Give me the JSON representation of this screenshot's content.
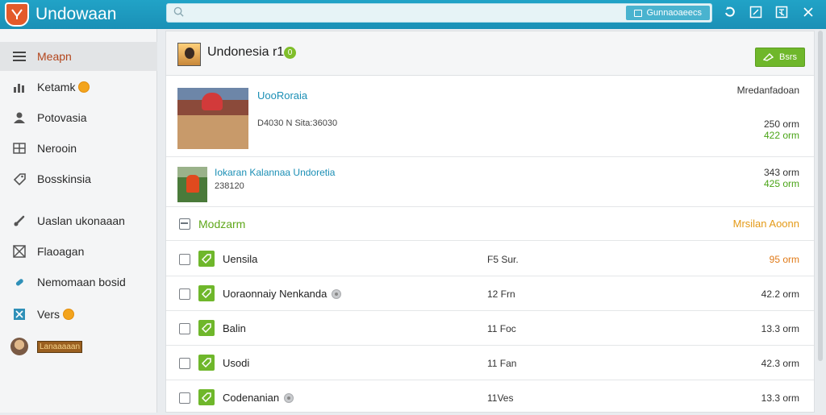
{
  "app": {
    "title": "Undowaan"
  },
  "search": {
    "placeholder": "",
    "tag_label": "Gunnaoaeecs"
  },
  "sidebar": {
    "items": [
      {
        "label": "Meapn",
        "icon": "menu-icon",
        "active": true
      },
      {
        "label": "Ketamk",
        "icon": "chart-icon"
      },
      {
        "label": "Potovasia",
        "icon": "person-icon"
      },
      {
        "label": "Nerooin",
        "icon": "grid-icon"
      },
      {
        "label": "Bosskinsia",
        "icon": "tag-icon"
      },
      {
        "label": "Uaslan ukonaaan",
        "icon": "link-icon"
      },
      {
        "label": "Flaoagan",
        "icon": "image-icon"
      },
      {
        "label": "Nemomaan bosid",
        "icon": "plug-icon"
      },
      {
        "label": "Vers",
        "icon": "share-icon"
      },
      {
        "label": "Lanaaaaan",
        "icon": "avatar"
      }
    ]
  },
  "header": {
    "title": "Undonesia r1",
    "badge": "0",
    "button_label": "Bsrs"
  },
  "posts": [
    {
      "title": "UooRoraia",
      "meta": "D4030 N Sita:36030",
      "right_label": "Mredanfadoan",
      "right_value": "250 orm",
      "right_sub": "422 orm"
    },
    {
      "title": "Iokaran Kalannaa Undoretia",
      "meta": "238120",
      "right_value": "343 orm",
      "right_sub": "425 orm"
    }
  ],
  "section": {
    "title": "Modzarm",
    "right_label": "Mrsilan Aoonn"
  },
  "rows": [
    {
      "name": "Uensila",
      "mid": "F5 Sur.",
      "value": "95 orm",
      "highlight": true,
      "info": false
    },
    {
      "name": "Uoraonnaiy Nenkanda",
      "mid": "12 Frn",
      "value": "42.2 orm",
      "highlight": false,
      "info": true
    },
    {
      "name": "Balin",
      "mid": "11 Foc",
      "value": "13.3 orm",
      "highlight": false,
      "info": false
    },
    {
      "name": "Usodi",
      "mid": "11 Fan",
      "value": "42.3 orm",
      "highlight": false,
      "info": false
    },
    {
      "name": "Codenanian",
      "mid": "11Ves",
      "value": "13.3 orm",
      "highlight": false,
      "info": true
    }
  ],
  "colors": {
    "topbar": "#1f9ec3",
    "accent_green": "#6fb72b",
    "accent_orange": "#e49a17",
    "link_blue": "#1b8fb5",
    "active_text": "#b3451c"
  }
}
